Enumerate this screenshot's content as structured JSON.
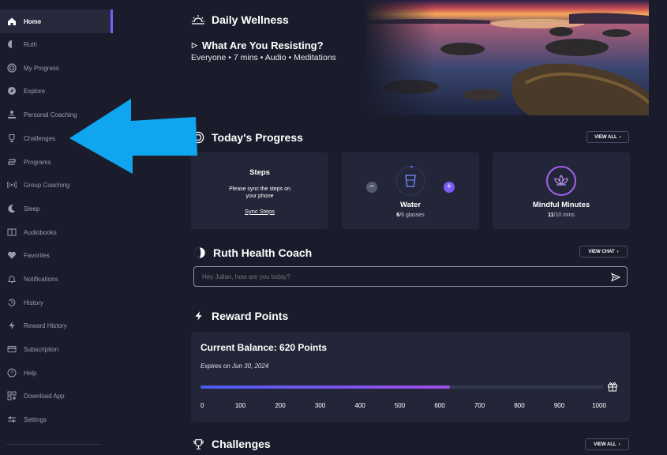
{
  "sidebar": {
    "items": [
      {
        "label": "Home",
        "icon": "home-icon",
        "active": true
      },
      {
        "label": "Ruth",
        "icon": "ruth-icon"
      },
      {
        "label": "My Progress",
        "icon": "progress-icon"
      },
      {
        "label": "Explore",
        "icon": "compass-icon"
      },
      {
        "label": "Personal Coaching",
        "icon": "coaching-icon"
      },
      {
        "label": "Challenges",
        "icon": "trophy-icon"
      },
      {
        "label": "Programs",
        "icon": "programs-icon"
      },
      {
        "label": "Group Coaching",
        "icon": "broadcast-icon"
      },
      {
        "label": "Sleep",
        "icon": "moon-icon"
      },
      {
        "label": "Audiobooks",
        "icon": "book-icon"
      },
      {
        "label": "Favorites",
        "icon": "heart-icon"
      },
      {
        "label": "Notifications",
        "icon": "bell-icon"
      },
      {
        "label": "History",
        "icon": "history-icon"
      },
      {
        "label": "Reward History",
        "icon": "bolt-icon"
      },
      {
        "label": "Subscription",
        "icon": "card-icon"
      },
      {
        "label": "Help",
        "icon": "help-icon"
      },
      {
        "label": "Download App",
        "icon": "qr-icon"
      },
      {
        "label": "Settings",
        "icon": "sliders-icon"
      }
    ]
  },
  "daily": {
    "title": "Daily Wellness",
    "session_title": "What Are You Resisting?",
    "session_meta": "Everyone • 7 mins • Audio • Meditations"
  },
  "progress": {
    "title": "Today's Progress",
    "view_all": "VIEW ALL",
    "steps": {
      "title": "Steps",
      "message": "Please sync the steps on your phone",
      "link": "Sync Steps"
    },
    "water": {
      "title": "Water",
      "current": "6",
      "suffix": "/6 glasses",
      "minus": "−",
      "plus": "+"
    },
    "mindful": {
      "title": "Mindful Minutes",
      "current": "11",
      "suffix": "/10 mins"
    }
  },
  "coach": {
    "title": "Ruth Health Coach",
    "view_chat": "VIEW CHAT",
    "placeholder": "Hey Julian, how are you today?"
  },
  "rewards": {
    "title": "Reward Points",
    "balance": "Current Balance: 620 Points",
    "expires": "Expires on Jun 30, 2024",
    "progress_value": 620,
    "progress_max": 1000,
    "ticks": [
      "0",
      "100",
      "200",
      "300",
      "400",
      "500",
      "600",
      "700",
      "800",
      "900",
      "1000"
    ]
  },
  "challenges": {
    "title": "Challenges",
    "view_all": "VIEW ALL"
  },
  "colors": {
    "accent": "#7b5cf5",
    "progress_start": "#4a5cf0",
    "progress_end": "#a24ee8",
    "arrow": "#0fa5ef"
  }
}
